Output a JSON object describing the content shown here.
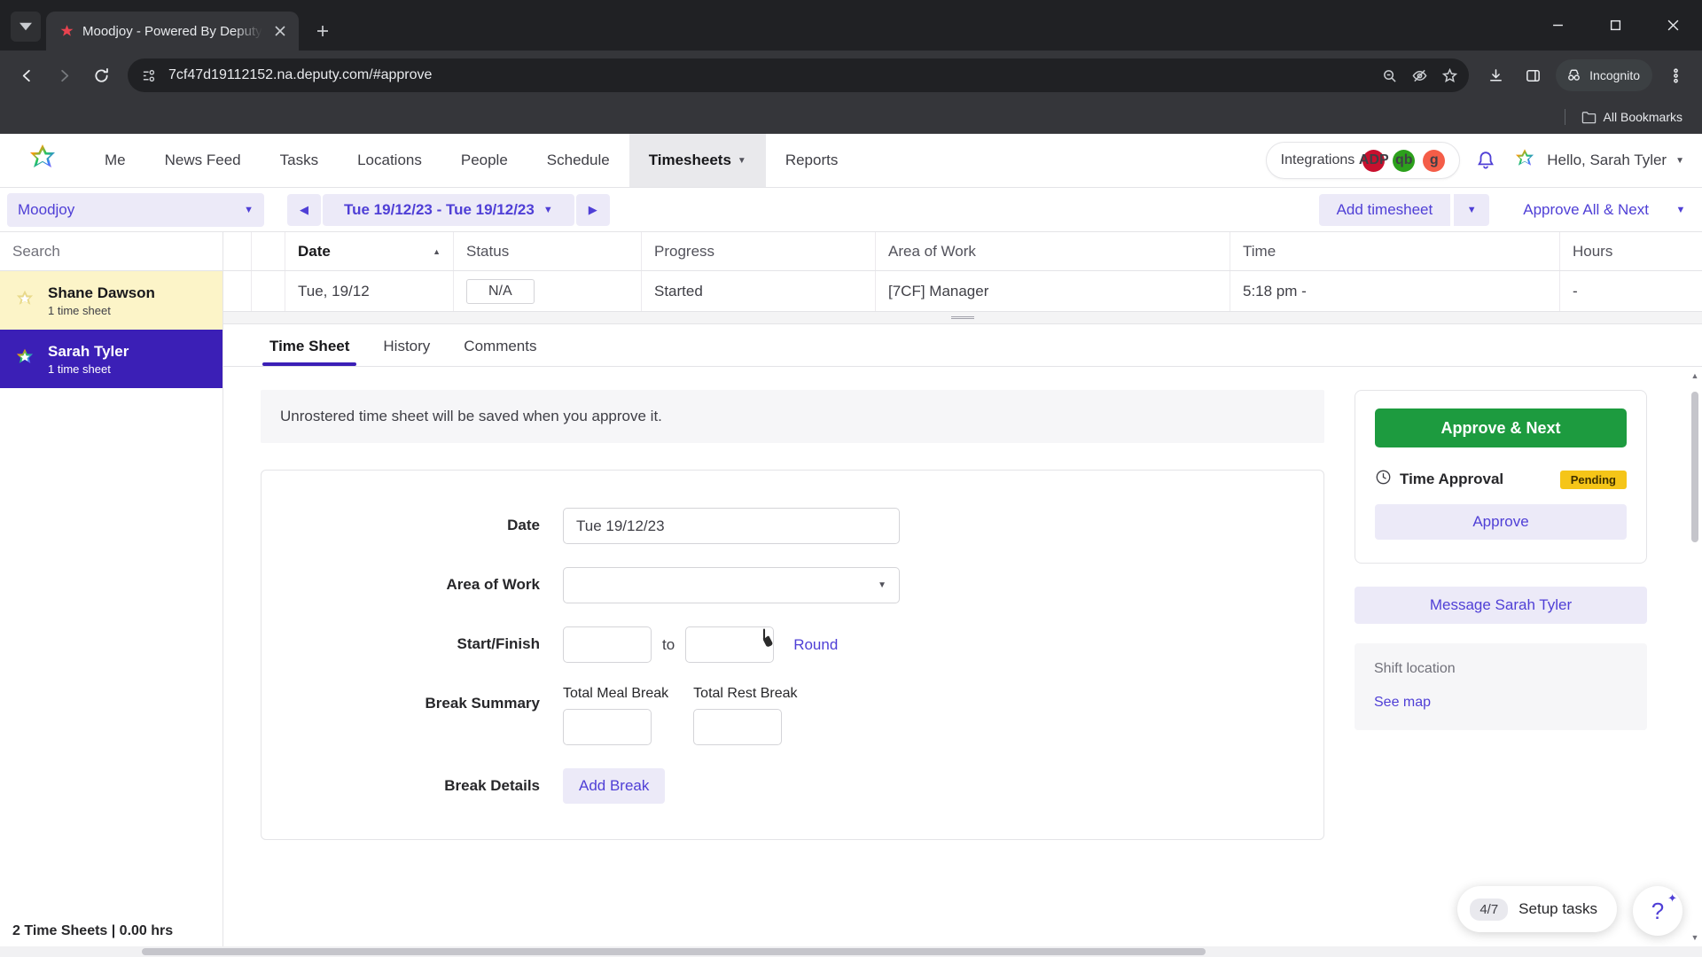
{
  "browser": {
    "tab": {
      "title": "Moodjoy - Powered By Deputy",
      "favicon": "deputy-star-icon"
    },
    "new_tab_label": "+",
    "url": "7cf47d19112152.na.deputy.com/#approve",
    "profile_label": "Incognito",
    "bookmarks_label": "All Bookmarks",
    "icons": {
      "tab_list": "chevron-down-icon",
      "back": "back-arrow-icon",
      "forward": "forward-arrow-icon",
      "reload": "reload-icon",
      "site_info": "page-info-icon",
      "zoom": "zoom-out-icon",
      "tracking": "eye-off-icon",
      "bookmark": "star-icon",
      "download": "download-icon",
      "side_panel": "side-panel-icon",
      "menu": "kebab-menu-icon",
      "minimize": "minimize-icon",
      "maximize": "maximize-icon",
      "close": "close-icon"
    }
  },
  "app": {
    "nav": {
      "items": [
        {
          "label": "Me",
          "active": false,
          "caret": false
        },
        {
          "label": "News Feed",
          "active": false,
          "caret": false
        },
        {
          "label": "Tasks",
          "active": false,
          "caret": false
        },
        {
          "label": "Locations",
          "active": false,
          "caret": false
        },
        {
          "label": "People",
          "active": false,
          "caret": false
        },
        {
          "label": "Schedule",
          "active": false,
          "caret": false
        },
        {
          "label": "Timesheets",
          "active": true,
          "caret": true
        },
        {
          "label": "Reports",
          "active": false,
          "caret": false
        }
      ],
      "integrations_label": "Integrations",
      "integration_badges": [
        {
          "name": "adp-icon",
          "text": "ADP",
          "color": "#c8102e"
        },
        {
          "name": "quickbooks-icon",
          "text": "qb",
          "color": "#2ca01c"
        },
        {
          "name": "gusto-icon",
          "text": "g",
          "color": "#f45d48"
        }
      ],
      "user_greeting": "Hello, Sarah Tyler"
    },
    "subbar": {
      "location": "Moodjoy",
      "date_range": "Tue 19/12/23 - Tue 19/12/23",
      "add_timesheet": "Add timesheet",
      "approve_all_next": "Approve All & Next"
    },
    "left": {
      "search_placeholder": "Search",
      "employees": [
        {
          "name": "Shane Dawson",
          "sub": "1 time sheet",
          "state": "highlight"
        },
        {
          "name": "Sarah Tyler",
          "sub": "1 time sheet",
          "state": "selected"
        }
      ],
      "footer": "2 Time Sheets | 0.00 hrs"
    },
    "table": {
      "columns": [
        "Date",
        "Status",
        "Progress",
        "Area of Work",
        "Time",
        "Hours"
      ],
      "rows": [
        {
          "date": "Tue, 19/12",
          "status": "N/A",
          "progress": "Started",
          "area_of_work": "[7CF] Manager",
          "time": "5:18 pm -",
          "hours": "-"
        }
      ]
    },
    "detail_tabs": [
      {
        "label": "Time Sheet",
        "active": true
      },
      {
        "label": "History",
        "active": false
      },
      {
        "label": "Comments",
        "active": false
      }
    ],
    "notice": "Unrostered time sheet will be saved when you approve it.",
    "form": {
      "date_label": "Date",
      "date_value": "Tue 19/12/23",
      "area_of_work_label": "Area of Work",
      "area_of_work_value": "",
      "start_finish_label": "Start/Finish",
      "start_value": "",
      "finish_value": "",
      "to_label": "to",
      "round_label": "Round",
      "break_summary_label": "Break Summary",
      "total_meal_break_label": "Total Meal Break",
      "total_meal_break_value": "",
      "total_rest_break_label": "Total Rest Break",
      "total_rest_break_value": "",
      "break_details_label": "Break Details",
      "add_break_label": "Add Break"
    },
    "approval": {
      "approve_next_label": "Approve & Next",
      "time_approval_label": "Time Approval",
      "status_badge": "Pending",
      "approve_label": "Approve",
      "message_label": "Message Sarah Tyler",
      "shift_location_label": "Shift location",
      "see_map_label": "See map"
    },
    "setup_tasks": {
      "fraction": "4/7",
      "label": "Setup tasks"
    },
    "help_label": "?"
  },
  "colors": {
    "brand_purple": "#4f3fd6",
    "selected_purple": "#3b1fb6",
    "approve_green": "#1d9b3f",
    "pending_yellow": "#f5c518",
    "highlight_yellow": "#fcf4c8"
  }
}
